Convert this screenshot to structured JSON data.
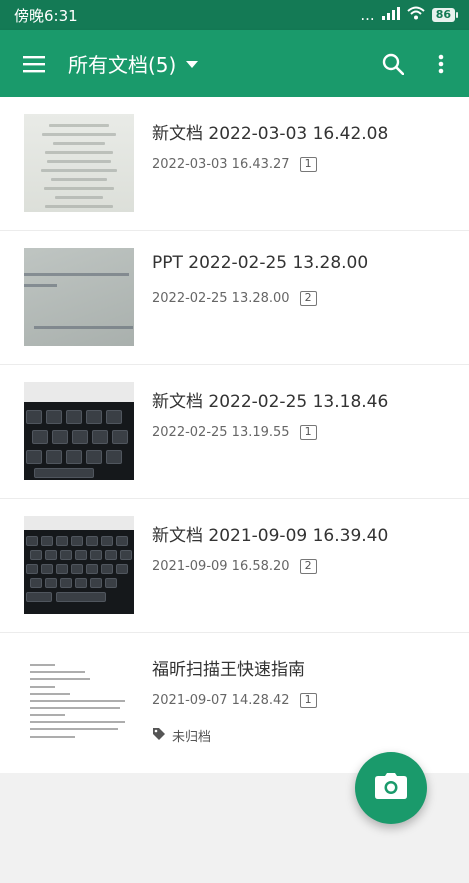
{
  "statusbar": {
    "time": "傍晚6:31",
    "battery": "86",
    "signal_dots": "..."
  },
  "appbar": {
    "title": "所有文档(5)",
    "menu_icon": "hamburger-menu-icon",
    "search_icon": "search-icon",
    "more_icon": "more-vertical-icon"
  },
  "documents": [
    {
      "title": "新文档 2022-03-03 16.42.08",
      "date": "2022-03-03 16.43.27",
      "pages": "1",
      "thumb": "document-photo"
    },
    {
      "title": "PPT 2022-02-25 13.28.00",
      "date": "2022-02-25 13.28.00",
      "pages": "2",
      "thumb": "ppt-photo"
    },
    {
      "title": "新文档 2022-02-25 13.18.46",
      "date": "2022-02-25 13.19.55",
      "pages": "1",
      "thumb": "keyboard-photo"
    },
    {
      "title": "新文档 2021-09-09 16.39.40",
      "date": "2021-09-09 16.58.20",
      "pages": "2",
      "thumb": "keyboard-photo"
    },
    {
      "title": "福昕扫描王快速指南",
      "date": "2021-09-07 14.28.42",
      "pages": "1",
      "thumb": "guide-page",
      "tag": "未归档"
    }
  ],
  "fab": {
    "icon": "camera-icon"
  },
  "colors": {
    "primary": "#1a9a6b",
    "status_bar": "#147a55"
  }
}
